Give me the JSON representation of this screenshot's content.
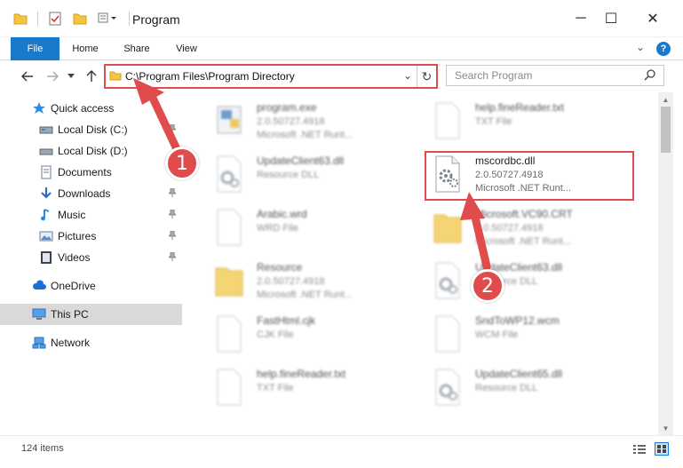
{
  "window": {
    "title": "Program",
    "minimize_glyph": "─",
    "maximize_glyph": "☐",
    "close_glyph": "✕"
  },
  "ribbon": {
    "tabs": [
      "File",
      "Home",
      "Share",
      "View"
    ],
    "help_glyph": "?",
    "collapse_glyph": "⌄"
  },
  "address": {
    "path": "C:\\Program Files\\Program Directory",
    "dropdown_glyph": "⌄",
    "refresh_glyph": "↻"
  },
  "search": {
    "placeholder": "Search Program",
    "icon_glyph": "⚲"
  },
  "sidebar": {
    "items": [
      {
        "label": "Quick access",
        "icon": "star-icon",
        "pinned": false
      },
      {
        "label": "Local Disk (C:)",
        "icon": "drive-icon",
        "pinned": true
      },
      {
        "label": "Local Disk (D:)",
        "icon": "drive-icon",
        "pinned": false
      },
      {
        "label": "Documents",
        "icon": "documents-icon",
        "pinned": true
      },
      {
        "label": "Downloads",
        "icon": "download-icon",
        "pinned": true
      },
      {
        "label": "Music",
        "icon": "music-icon",
        "pinned": true
      },
      {
        "label": "Pictures",
        "icon": "pictures-icon",
        "pinned": true
      },
      {
        "label": "Videos",
        "icon": "videos-icon",
        "pinned": true
      },
      {
        "label": "OneDrive",
        "icon": "cloud-icon",
        "pinned": false
      },
      {
        "label": "This PC",
        "icon": "computer-icon",
        "pinned": false,
        "selected": true
      },
      {
        "label": "Network",
        "icon": "network-icon",
        "pinned": false
      }
    ],
    "pin_glyph": "📌"
  },
  "files": [
    {
      "name": "program.exe",
      "line1": "2.0.50727.4918",
      "line2": "Microsoft .NET Runt...",
      "icon": "exe-icon",
      "blurred": true
    },
    {
      "name": "help.fineReader.txt",
      "line1": "TXT File",
      "line2": "",
      "icon": "text-file-icon",
      "blurred": true
    },
    {
      "name": "UpdateClient63.dll",
      "line1": "Resource DLL",
      "line2": "",
      "icon": "dll-icon",
      "blurred": true
    },
    {
      "name": "mscordbc.dll",
      "line1": "2.0.50727.4918",
      "line2": "Microsoft .NET Runt...",
      "icon": "dll-icon",
      "blurred": false
    },
    {
      "name": "Arabic.wrd",
      "line1": "WRD File",
      "line2": "",
      "icon": "blank-file-icon",
      "blurred": true
    },
    {
      "name": "Microsoft.VC90.CRT",
      "line1": "2.0.50727.4918",
      "line2": "Microsoft .NET Runt...",
      "icon": "folder-icon",
      "blurred": true
    },
    {
      "name": "Resource",
      "line1": "2.0.50727.4918",
      "line2": "Microsoft .NET Runt...",
      "icon": "folder-icon",
      "blurred": true
    },
    {
      "name": "UpdateClient63.dll",
      "line1": "Resource DLL",
      "line2": "",
      "icon": "dll-icon",
      "blurred": true
    },
    {
      "name": "FastHtml.cjk",
      "line1": "CJK File",
      "line2": "",
      "icon": "blank-file-icon",
      "blurred": true
    },
    {
      "name": "SndToWP12.wcm",
      "line1": "WCM File",
      "line2": "",
      "icon": "blank-file-icon",
      "blurred": true
    },
    {
      "name": "help.fineReader.txt",
      "line1": "TXT File",
      "line2": "",
      "icon": "text-file-icon",
      "blurred": true
    },
    {
      "name": "UpdateClient65.dll",
      "line1": "Resource DLL",
      "line2": "",
      "icon": "dll-icon",
      "blurred": true
    }
  ],
  "status": {
    "item_count": "124 items"
  },
  "annotations": {
    "marker1": "1",
    "marker2": "2",
    "color": "#e04b4b"
  },
  "colors": {
    "accent": "#1979ca",
    "highlight": "#e04b4b",
    "selected_bg": "#d9d9d9"
  }
}
